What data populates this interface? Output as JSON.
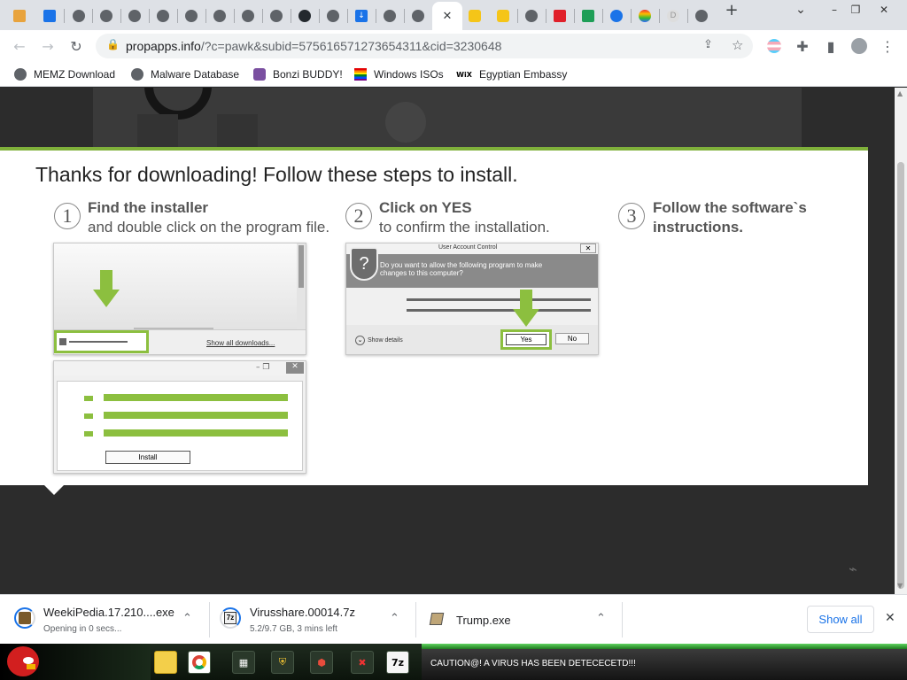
{
  "browser": {
    "url_host": "propapps.info",
    "url_rest": "/?c=pawk&subid=575616571273654311&cid=3230648",
    "new_tab_symbol": "+",
    "tab_search_symbol": "⌄"
  },
  "bookmarks": [
    {
      "label": "MEMZ Download",
      "icon": "globe-icon"
    },
    {
      "label": "Malware Database",
      "icon": "globe-icon"
    },
    {
      "label": "Bonzi BUDDY!",
      "icon": "bonzi-icon"
    },
    {
      "label": "Windows ISOs",
      "icon": "rainbow-flag-icon"
    },
    {
      "label": "Egyptian Embassy",
      "icon": "wix-icon",
      "icon_text": "WiX"
    }
  ],
  "page": {
    "title": "Thanks for downloading! Follow these steps to install.",
    "steps": [
      {
        "num": "1",
        "title": "Find the installer",
        "sub": "and double click on the program file."
      },
      {
        "num": "2",
        "title": "Click on YES",
        "sub": "to confirm the installation."
      },
      {
        "num": "3",
        "title": "Follow the software`s",
        "sub": "instructions."
      }
    ],
    "illus1": {
      "show_all": "Show all downloads...",
      "install": "Install"
    },
    "illus2": {
      "title": "User Account Control",
      "question": "Do you want to allow the following program to make changes to this computer?",
      "show_details": "Show details",
      "yes": "Yes",
      "no": "No"
    }
  },
  "downloads": [
    {
      "name": "WeekiPedia.17.210....exe",
      "status": "Opening in 0 secs..."
    },
    {
      "name": "Virusshare.00014.7z",
      "status": "5.2/9.7 GB, 3 mins left"
    },
    {
      "name": "Trump.exe",
      "status": ""
    }
  ],
  "shelf": {
    "show_all": "Show all",
    "close": "✕"
  },
  "taskbar": {
    "caution": "CAUTION@! A VIRUS HAS BEEN DETECECETD!!!",
    "seven_zip": "7z"
  },
  "colors": {
    "accent_green": "#7fb03a",
    "chrome_bg": "#dee1e6",
    "link_blue": "#1a73e8"
  }
}
